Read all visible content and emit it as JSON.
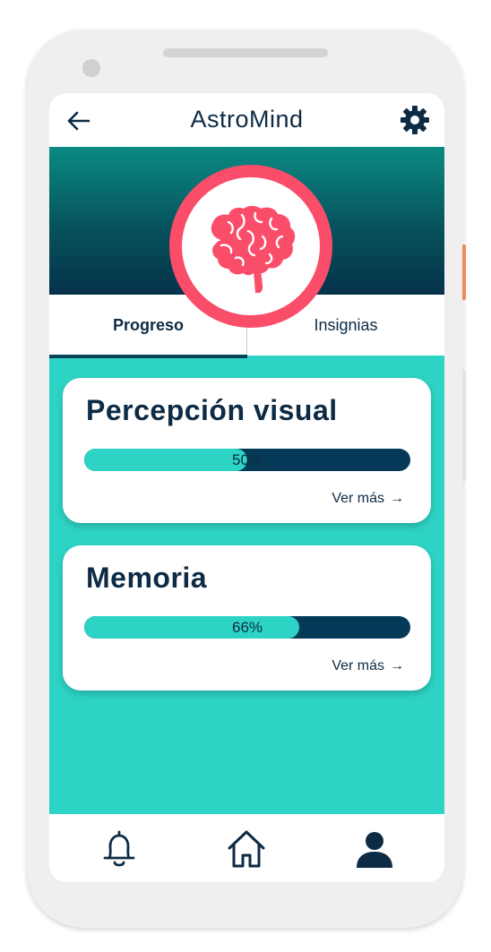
{
  "app": {
    "title": "AstroMind"
  },
  "tabs": [
    {
      "label": "Progreso",
      "active": true
    },
    {
      "label": "Insignias",
      "active": false
    }
  ],
  "cards": [
    {
      "title": "Percepción visual",
      "progress": 50,
      "progress_label": "50%",
      "link": "Ver más",
      "link_arrow": "→"
    },
    {
      "title": "Memoria",
      "progress": 66,
      "progress_label": "66%",
      "link": "Ver más",
      "link_arrow": "→"
    }
  ],
  "icons": {
    "back": "arrow-left-icon",
    "settings": "gear-icon",
    "hero": "brain-icon",
    "nav": [
      "bell-icon",
      "home-icon",
      "user-icon"
    ]
  },
  "colors": {
    "accent": "#2dd3c4",
    "dark": "#0d2b45",
    "bar_track": "#043a58",
    "ring": "#fa4d6a"
  }
}
